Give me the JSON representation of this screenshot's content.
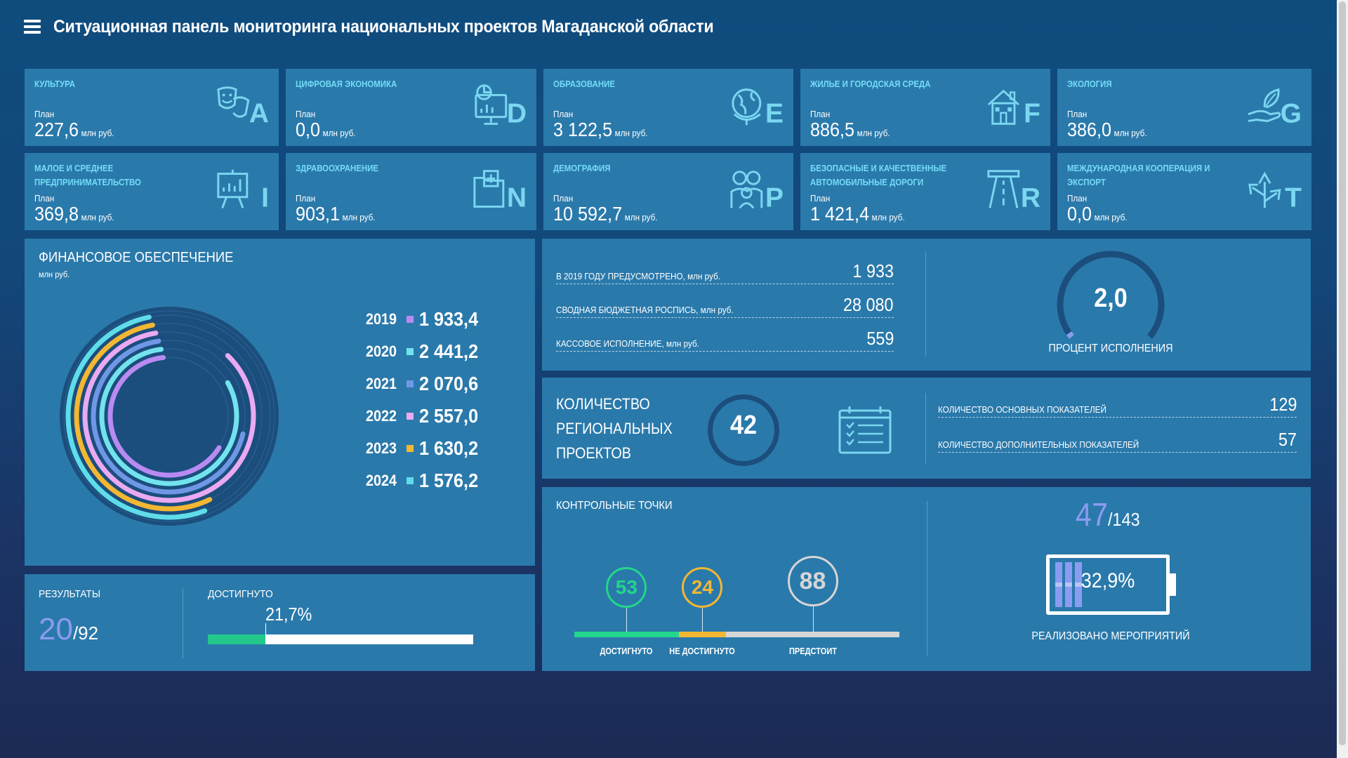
{
  "header": {
    "title": "Ситуационная панель мониторинга национальных проектов Магаданской области"
  },
  "projects": [
    {
      "name": "Культура",
      "plan_label": "План",
      "value": "227,6",
      "unit": "млн руб.",
      "letter": "A",
      "icon": "theater-masks-icon"
    },
    {
      "name": "Цифровая экономика",
      "plan_label": "План",
      "value": "0,0",
      "unit": "млн руб.",
      "letter": "D",
      "icon": "computer-chart-icon"
    },
    {
      "name": "Образование",
      "plan_label": "План",
      "value": "3 122,5",
      "unit": "млн руб.",
      "letter": "E",
      "icon": "globe-icon"
    },
    {
      "name": "Жилье и городская среда",
      "plan_label": "План",
      "value": "886,5",
      "unit": "млн руб.",
      "letter": "F",
      "icon": "house-icon"
    },
    {
      "name": "Экология",
      "plan_label": "План",
      "value": "386,0",
      "unit": "млн руб.",
      "letter": "G",
      "icon": "hand-leaf-icon"
    },
    {
      "name": "Малое и среднее предпринимательство",
      "plan_label": "План",
      "value": "369,8",
      "unit": "млн руб.",
      "letter": "I",
      "icon": "presentation-board-icon"
    },
    {
      "name": "Здравоохранение",
      "plan_label": "План",
      "value": "903,1",
      "unit": "млн руб.",
      "letter": "N",
      "icon": "medical-folder-icon"
    },
    {
      "name": "Демография",
      "plan_label": "План",
      "value": "10 592,7",
      "unit": "млн руб.",
      "letter": "P",
      "icon": "family-icon"
    },
    {
      "name": "Безопасные и качественные автомобильные дороги",
      "plan_label": "План",
      "value": "1 421,4",
      "unit": "млн руб.",
      "letter": "R",
      "icon": "road-icon"
    },
    {
      "name": "Международная кооперация и экспорт",
      "plan_label": "План",
      "value": "0,0",
      "unit": "млн руб.",
      "letter": "T",
      "icon": "export-arrows-icon"
    }
  ],
  "finance": {
    "title": "ФИНАНСОВОЕ ОБЕСПЕЧЕНИЕ",
    "subtitle": "млн руб.",
    "rows": [
      {
        "year": "2019",
        "value": "1 933,4",
        "color": "#b98af2"
      },
      {
        "year": "2020",
        "value": "2 441,2",
        "color": "#72e3ee"
      },
      {
        "year": "2021",
        "value": "2 070,6",
        "color": "#7097e6"
      },
      {
        "year": "2022",
        "value": "2 557,0",
        "color": "#eaa9f2"
      },
      {
        "year": "2023",
        "value": "1 630,2",
        "color": "#f3b733"
      },
      {
        "year": "2024",
        "value": "1 576,2",
        "color": "#5fdcea"
      }
    ]
  },
  "budget": {
    "rows": [
      {
        "label": "В 2019 ГОДУ ПРЕДУСМОТРЕНО, млн руб.",
        "value": "1 933"
      },
      {
        "label": "СВОДНАЯ БЮДЖЕТНАЯ РОСПИСЬ, млн руб.",
        "value": "28 080"
      },
      {
        "label": "КАССОВОЕ ИСПОЛНЕНИЕ, млн руб.",
        "value": "559"
      }
    ],
    "gauge_value": "2,0",
    "gauge_percent": 2.0,
    "gauge_label": "ПРОЦЕНТ ИСПОЛНЕНИЯ"
  },
  "regional": {
    "title_lines": [
      "КОЛИЧЕСТВО",
      "РЕГИОНАЛЬНЫХ",
      "ПРОЕКТОВ"
    ],
    "count": "42",
    "rows": [
      {
        "label": "КОЛИЧЕСТВО ОСНОВНЫХ ПОКАЗАТЕЛЕЙ",
        "value": "129"
      },
      {
        "label": "КОЛИЧЕСТВО ДОПОЛНИТЕЛЬНЫХ ПОКАЗАТЕЛЕЙ",
        "value": "57"
      }
    ]
  },
  "results": {
    "title": "РЕЗУЛЬТАТЫ",
    "achieved": "20",
    "total": "/92",
    "progress_title": "ДОСТИГНУТО",
    "progress_text": "21,7%",
    "progress_percent": 21.7
  },
  "checkpoints": {
    "title": "КОНТРОЛЬНЫЕ ТОЧКИ",
    "items": [
      {
        "value": "53",
        "label": "ДОСТИГНУТО",
        "color": "#22d68a"
      },
      {
        "value": "24",
        "label": "НЕ ДОСТИГНУТО",
        "color": "#f3b733"
      },
      {
        "value": "88",
        "label": "ПРЕДСТОИТ",
        "color": "#d6d6d6"
      }
    ]
  },
  "events": {
    "done": "47",
    "total": "/143",
    "percent_text": "32,9%",
    "percent": 32.9,
    "label": "РЕАЛИЗОВАНО МЕРОПРИЯТИЙ"
  },
  "colors": {
    "card": "#2a79ab",
    "accent_label": "#74dcf7",
    "green": "#22d68a",
    "orange": "#f3b733",
    "purple": "#8a9cf0"
  }
}
